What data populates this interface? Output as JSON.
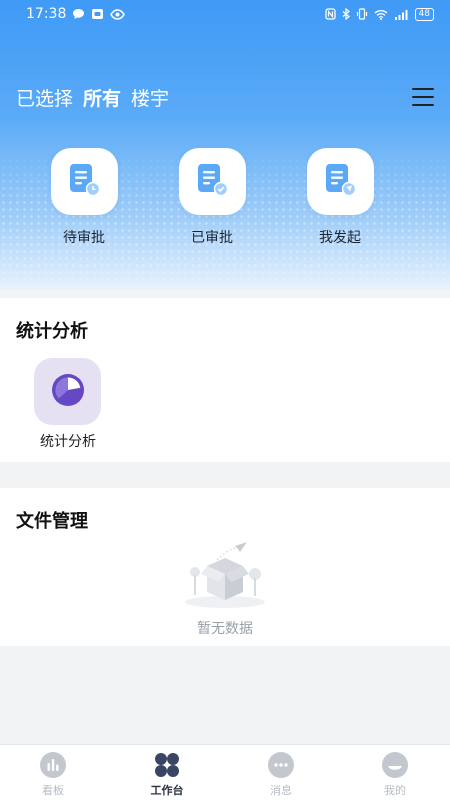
{
  "status_bar": {
    "time": "17:38",
    "battery": "48"
  },
  "header": {
    "prefix": "已选择",
    "selected": "所有",
    "suffix": "楼宇"
  },
  "shortcuts": [
    {
      "label": "待审批",
      "icon": "pending-doc-icon"
    },
    {
      "label": "已审批",
      "icon": "approved-doc-icon"
    },
    {
      "label": "我发起",
      "icon": "initiated-doc-icon"
    }
  ],
  "stats_section": {
    "title": "统计分析",
    "items": [
      {
        "label": "统计分析",
        "icon": "pie-chart-icon"
      }
    ]
  },
  "files_section": {
    "title": "文件管理",
    "empty_text": "暂无数据"
  },
  "tabbar": {
    "items": [
      {
        "label": "看板",
        "icon": "dashboard-icon",
        "active": false
      },
      {
        "label": "工作台",
        "icon": "workbench-icon",
        "active": true
      },
      {
        "label": "消息",
        "icon": "message-icon",
        "active": false
      },
      {
        "label": "我的",
        "icon": "profile-icon",
        "active": false
      }
    ]
  },
  "colors": {
    "primary": "#3f9af6",
    "doc_icon": "#5aa8f6",
    "stat_bg": "#e6e1f2",
    "stat_icon": "#6648c4",
    "tab_inactive": "#b6bcc5",
    "tab_active": "#384563"
  }
}
